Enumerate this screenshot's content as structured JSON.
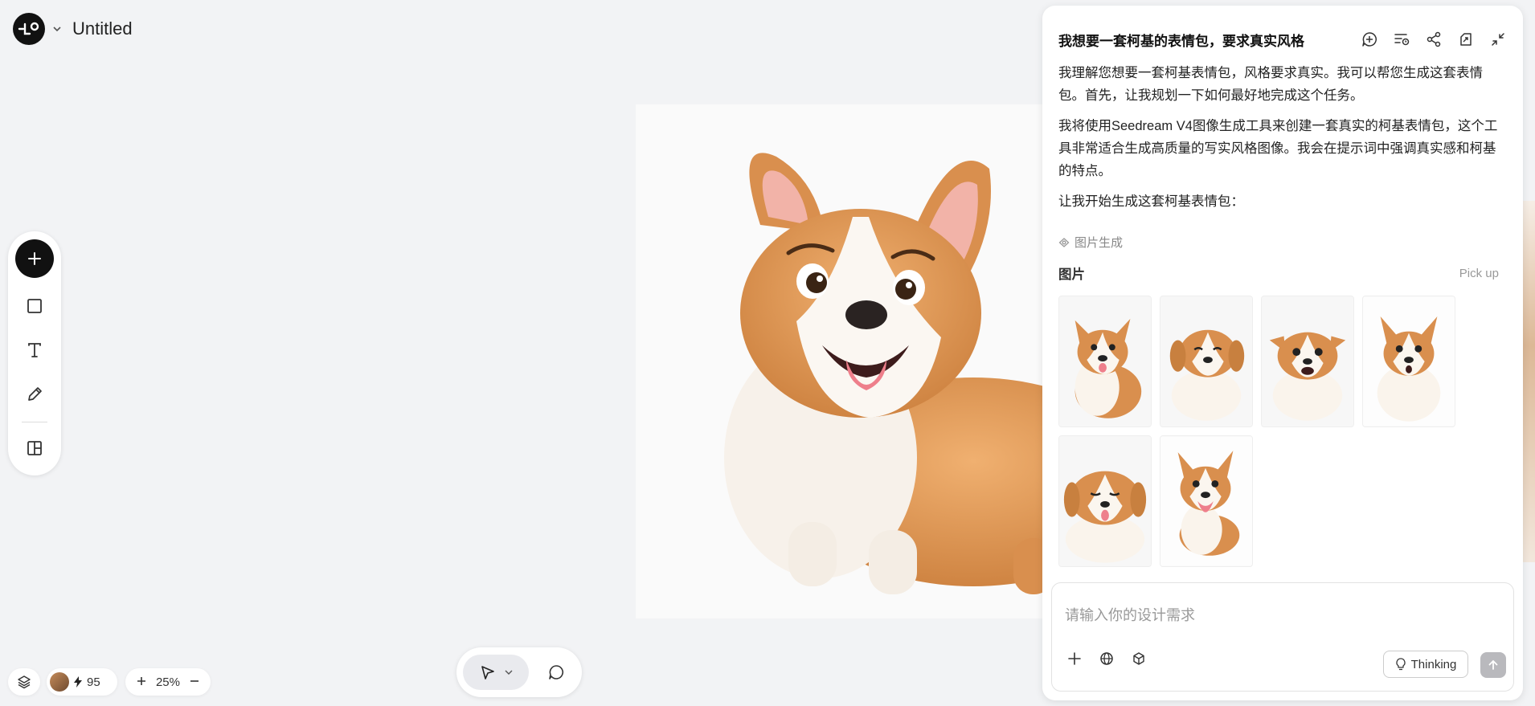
{
  "header": {
    "title": "Untitled"
  },
  "zoom": {
    "level": "25%"
  },
  "credits": {
    "count": "95"
  },
  "chat": {
    "title": "我想要一套柯基的表情包，要求真实风格",
    "messages": [
      "我理解您想要一套柯基表情包，风格要求真实。我可以帮您生成这套表情包。首先，让我规划一下如何最好地完成这个任务。",
      "我将使用Seedream V4图像生成工具来创建一套真实的柯基表情包，这个工具非常适合生成高质量的写实风格图像。我会在提示词中强调真实感和柯基的特点。",
      "让我开始生成这套柯基表情包："
    ],
    "tool_tag": "图片生成",
    "images_label": "图片",
    "pickup_label": "Pick up",
    "thumbnails": [
      {
        "expression": "happy-tongue"
      },
      {
        "expression": "sad"
      },
      {
        "expression": "shocked"
      },
      {
        "expression": "surprised"
      },
      {
        "expression": "sleepy-tongue"
      },
      {
        "expression": "running-happy"
      }
    ]
  },
  "input": {
    "placeholder": "请输入你的设计需求",
    "thinking_label": "Thinking"
  },
  "colors": {
    "accent": "#111111",
    "panel_bg": "#ffffff",
    "canvas_bg": "#f2f3f5",
    "corgi_orange": "#d98f4e"
  }
}
